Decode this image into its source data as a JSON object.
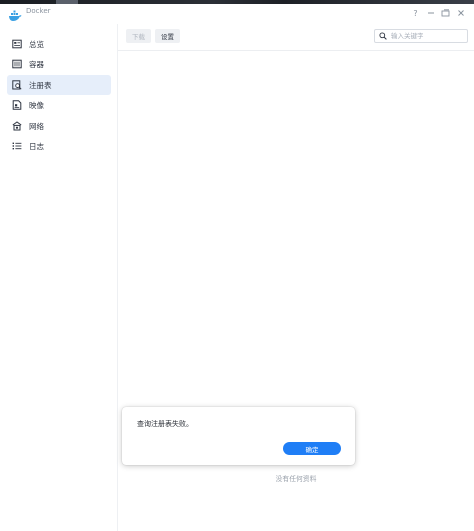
{
  "window": {
    "title": "Docker",
    "controls": [
      "help-icon",
      "minimize-icon",
      "pin-icon",
      "close-icon"
    ]
  },
  "sidebar": {
    "items": [
      {
        "label": "总览",
        "icon": "overview-icon",
        "active": false
      },
      {
        "label": "容器",
        "icon": "container-icon",
        "active": false
      },
      {
        "label": "注册表",
        "icon": "registry-icon",
        "active": true
      },
      {
        "label": "映像",
        "icon": "image-icon",
        "active": false
      },
      {
        "label": "网络",
        "icon": "network-icon",
        "active": false
      },
      {
        "label": "日志",
        "icon": "log-icon",
        "active": false
      }
    ]
  },
  "toolbar": {
    "download_label": "下载",
    "settings_label": "设置",
    "search_placeholder": "输入关键字"
  },
  "main": {
    "empty_text": "没有任何资料"
  },
  "dialog": {
    "message": "查询注册表失败。",
    "ok_label": "确定"
  },
  "colors": {
    "accent": "#1f7ef6",
    "active_nav_bg": "#e6eefa",
    "docker_blue": "#3aa0e3"
  }
}
